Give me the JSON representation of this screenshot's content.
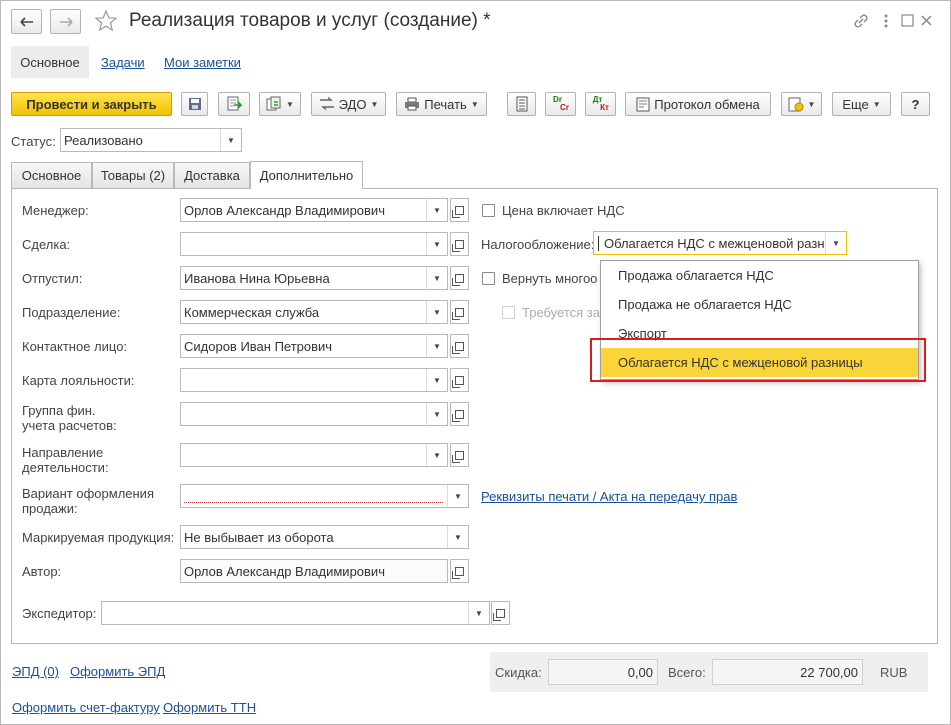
{
  "window": {
    "title": "Реализация товаров и услуг (создание) *",
    "nav_back_icon": "arrow-left-icon",
    "nav_forward_icon": "arrow-right-icon",
    "star_icon": "star-icon",
    "link_icon": "chain-link-icon",
    "more_icon": "vertical-dots-icon",
    "maximize_icon": "square-icon",
    "close_icon": "close-icon"
  },
  "nav_tabs": [
    "Основное",
    "Задачи",
    "Мои заметки"
  ],
  "toolbar": {
    "post_close": "Провести и закрыть",
    "edo": "ЭДО",
    "print": "Печать",
    "exchange_protocol": "Протокол обмена",
    "more": "Еще",
    "help": "?",
    "dr_label": "Dr",
    "cr_label": "Cr",
    "dt_label": "Дт",
    "kt_label": "Кт"
  },
  "status": {
    "label": "Статус:",
    "value": "Реализовано"
  },
  "tabs": [
    "Основное",
    "Товары (2)",
    "Доставка",
    "Дополнительно"
  ],
  "active_tab": "Дополнительно",
  "form": {
    "manager": {
      "label": "Менеджер:",
      "value": "Орлов Александр Владимирович"
    },
    "deal": {
      "label": "Сделка:",
      "value": ""
    },
    "released": {
      "label": "Отпустил:",
      "value": "Иванова Нина Юрьевна"
    },
    "department": {
      "label": "Подразделение:",
      "value": "Коммерческая служба"
    },
    "contact": {
      "label": "Контактное лицо:",
      "value": "Сидоров Иван Петрович"
    },
    "loyalty": {
      "label": "Карта лояльности:",
      "value": ""
    },
    "fin_group_l1": "Группа фин.",
    "fin_group_l2": "учета расчетов:",
    "direction_l1": "Направление",
    "direction_l2": "деятельности:",
    "variant_l1": "Вариант оформления",
    "variant_l2": "продажи:",
    "marked": {
      "label": "Маркируемая продукция:",
      "value": "Не выбывает из оборота"
    },
    "author": {
      "label": "Автор:",
      "value": "Орлов Александр Владимирович"
    },
    "forwarder": {
      "label": "Экспедитор:",
      "value": ""
    }
  },
  "right": {
    "price_incl_vat": "Цена включает НДС",
    "tax_label": "Налогообложение:",
    "tax_value": "Облагается НДС с межценовой разни",
    "return_reusable": "Вернуть многоо",
    "requires": "Требуется за",
    "print_requisites_link": "Реквизиты печати / Акта на передачу прав"
  },
  "dropdown": {
    "items": [
      "Продажа облагается НДС",
      "Продажа не облагается НДС",
      "Экспорт",
      "Облагается НДС с межценовой разницы"
    ],
    "selected_index": 3
  },
  "footer": {
    "epd": "ЭПД (0)",
    "make_epd": "Оформить ЭПД",
    "discount_label": "Скидка:",
    "discount_value": "0,00",
    "total_label": "Всего:",
    "total_value": "22 700,00",
    "currency": "RUB",
    "invoice_link": "Оформить счет-фактуру",
    "ttn_link": "Оформить ТТН"
  },
  "colors": {
    "accent_yellow": "#f5c800",
    "highlight_red": "#e0191e",
    "link": "#1a4f9c",
    "selected_item": "#f9d53a"
  }
}
